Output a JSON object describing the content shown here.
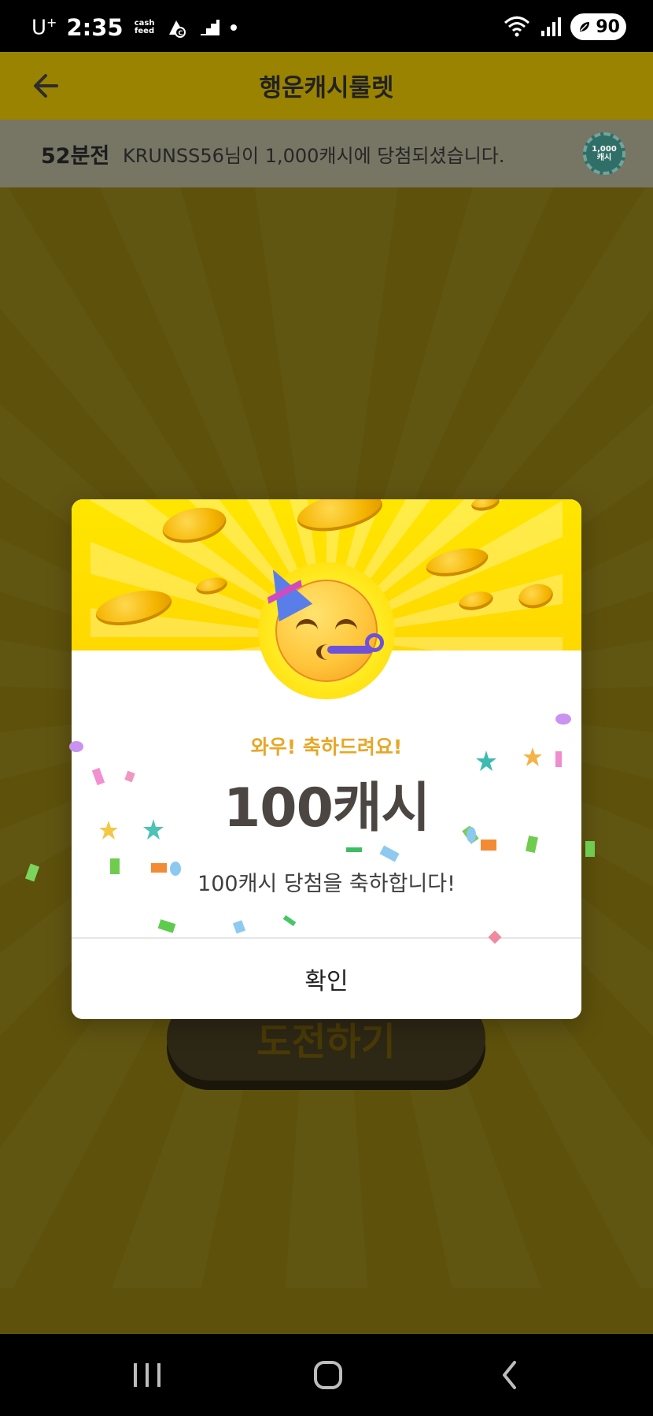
{
  "status_bar": {
    "carrier": "U",
    "carrier_sup": "+",
    "time": "2:35",
    "cashfeed_top": "cash",
    "cashfeed_bottom": "feed",
    "battery": "90"
  },
  "header": {
    "title": "행운캐시룰렛",
    "back_icon": "arrow-left-icon"
  },
  "ticker": {
    "time": "52분전",
    "message": "KRUNSS56님이 1,000캐시에 당첨되셨습니다.",
    "chip_amount": "1,000",
    "chip_label": "캐시"
  },
  "challenge_button": {
    "label": "도전하기"
  },
  "dialog": {
    "headline": "와우! 축하드려요!",
    "amount": "100캐시",
    "message": "100캐시 당첨을 축하합니다!",
    "confirm_label": "확인"
  },
  "nav": {
    "recent_icon": "recent-apps-icon",
    "home_icon": "home-icon",
    "back_icon": "back-icon"
  },
  "colors": {
    "accent": "#ffd800",
    "headline": "#e8a727",
    "amount": "#4c4643"
  }
}
